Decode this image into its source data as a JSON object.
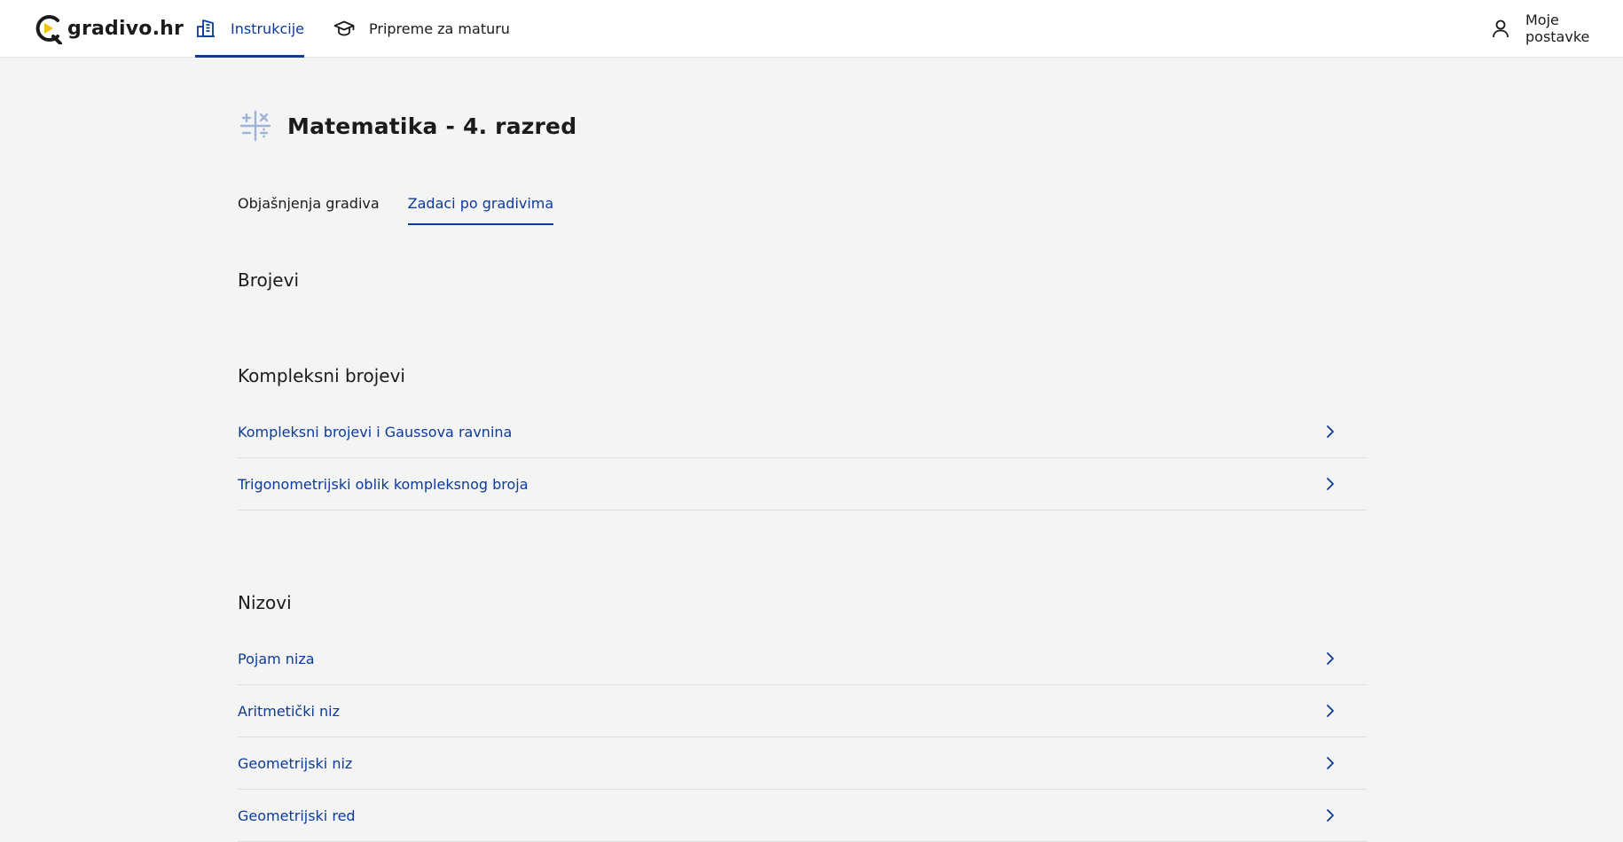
{
  "nav": {
    "logo_text": "gradivo.hr",
    "items": [
      {
        "label": "Instrukcije",
        "icon": "building-icon",
        "active": true
      },
      {
        "label": "Pripreme za maturu",
        "icon": "graduation-cap-icon",
        "active": false
      }
    ],
    "user": {
      "label": "Moje postavke",
      "icon": "user-icon"
    }
  },
  "page": {
    "title": "Matematika - 4. razred",
    "icon": "math-operators-icon"
  },
  "tabs": [
    {
      "label": "Objašnjenja gradiva",
      "active": false
    },
    {
      "label": "Zadaci po gradivima",
      "active": true
    }
  ],
  "sections": [
    {
      "title": "Brojevi",
      "items": []
    },
    {
      "title": "Kompleksni brojevi",
      "items": [
        {
          "label": "Kompleksni brojevi i Gaussova ravnina"
        },
        {
          "label": "Trigonometrijski oblik kompleksnog broja"
        }
      ]
    },
    {
      "title": "Nizovi",
      "items": [
        {
          "label": "Pojam niza"
        },
        {
          "label": "Aritmetički niz"
        },
        {
          "label": "Geometrijski niz"
        },
        {
          "label": "Geometrijski red"
        }
      ]
    }
  ],
  "colors": {
    "accent": "#0b3b9a",
    "background": "#f4f4f4",
    "logo_accent": "#f5c400"
  }
}
